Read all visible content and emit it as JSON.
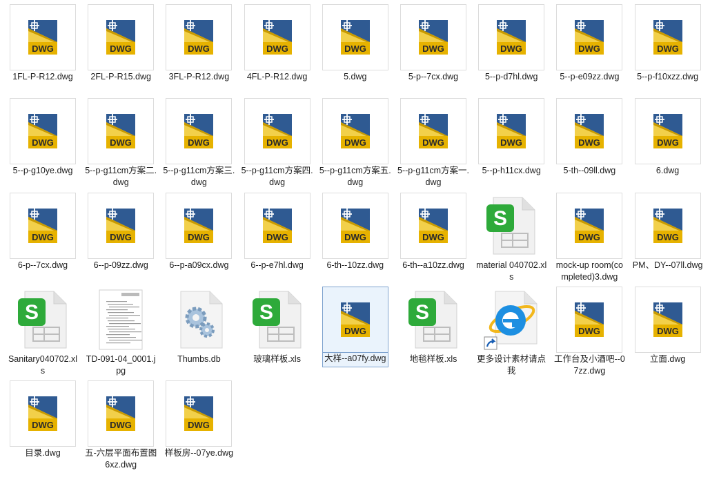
{
  "files": [
    {
      "name": "1FL-P-R12.dwg",
      "icon": "dwg-file-icon"
    },
    {
      "name": "2FL-P-R15.dwg",
      "icon": "dwg-file-icon"
    },
    {
      "name": "3FL-P-R12.dwg",
      "icon": "dwg-file-icon"
    },
    {
      "name": "4FL-P-R12.dwg",
      "icon": "dwg-file-icon"
    },
    {
      "name": "5.dwg",
      "icon": "dwg-file-icon"
    },
    {
      "name": "5-p--7cx.dwg",
      "icon": "dwg-file-icon"
    },
    {
      "name": "5--p-d7hl.dwg",
      "icon": "dwg-file-icon"
    },
    {
      "name": "5--p-e09zz.dwg",
      "icon": "dwg-file-icon"
    },
    {
      "name": "5--p-f10xzz.dwg",
      "icon": "dwg-file-icon"
    },
    {
      "name": "5--p-g10ye.dwg",
      "icon": "dwg-file-icon"
    },
    {
      "name": "5--p-g11cm方案二.dwg",
      "icon": "dwg-file-icon"
    },
    {
      "name": "5--p-g11cm方案三.dwg",
      "icon": "dwg-file-icon"
    },
    {
      "name": "5--p-g11cm方案四.dwg",
      "icon": "dwg-file-icon"
    },
    {
      "name": "5--p-g11cm方案五.dwg",
      "icon": "dwg-file-icon"
    },
    {
      "name": "5--p-g11cm方案一.dwg",
      "icon": "dwg-file-icon"
    },
    {
      "name": "5--p-h11cx.dwg",
      "icon": "dwg-file-icon"
    },
    {
      "name": "5-th--09ll.dwg",
      "icon": "dwg-file-icon"
    },
    {
      "name": "6.dwg",
      "icon": "dwg-file-icon"
    },
    {
      "name": "6-p--7cx.dwg",
      "icon": "dwg-file-icon"
    },
    {
      "name": "6--p-09zz.dwg",
      "icon": "dwg-file-icon"
    },
    {
      "name": "6--p-a09cx.dwg",
      "icon": "dwg-file-icon"
    },
    {
      "name": "6--p-e7hl.dwg",
      "icon": "dwg-file-icon"
    },
    {
      "name": "6-th--10zz.dwg",
      "icon": "dwg-file-icon"
    },
    {
      "name": "6-th--a10zz.dwg",
      "icon": "dwg-file-icon"
    },
    {
      "name": "material 040702.xls",
      "icon": "spreadsheet-file-icon"
    },
    {
      "name": "mock-up room(completed)3.dwg",
      "icon": "dwg-file-icon"
    },
    {
      "name": "PM、DY--07ll.dwg",
      "icon": "dwg-file-icon"
    },
    {
      "name": "Sanitary040702.xls",
      "icon": "spreadsheet-file-icon"
    },
    {
      "name": "TD-091-04_0001.jpg",
      "icon": "document-thumbnail-icon"
    },
    {
      "name": "Thumbs.db",
      "icon": "gears-file-icon"
    },
    {
      "name": "玻璃样板.xls",
      "icon": "spreadsheet-file-icon"
    },
    {
      "name": "大样--a07fy.dwg",
      "icon": "dwg-file-icon",
      "selected": true
    },
    {
      "name": "地毯样板.xls",
      "icon": "spreadsheet-file-icon"
    },
    {
      "name": "更多设计素材请点我",
      "icon": "internet-explorer-shortcut-icon"
    },
    {
      "name": "工作台及小酒吧--07zz.dwg",
      "icon": "dwg-file-icon"
    },
    {
      "name": "立面.dwg",
      "icon": "dwg-file-icon"
    },
    {
      "name": "目录.dwg",
      "icon": "dwg-file-icon"
    },
    {
      "name": "五-六层平面布置图6xz.dwg",
      "icon": "dwg-file-icon"
    },
    {
      "name": "样板房--07ye.dwg",
      "icon": "dwg-file-icon"
    }
  ],
  "dwg_label": "DWG",
  "colors": {
    "dwg_blue": "#2a4f86",
    "dwg_yellow": "#e8b400",
    "xls_green": "#2eaa3a",
    "ie_blue": "#1a8fe0",
    "selection": "#7da2ce"
  }
}
